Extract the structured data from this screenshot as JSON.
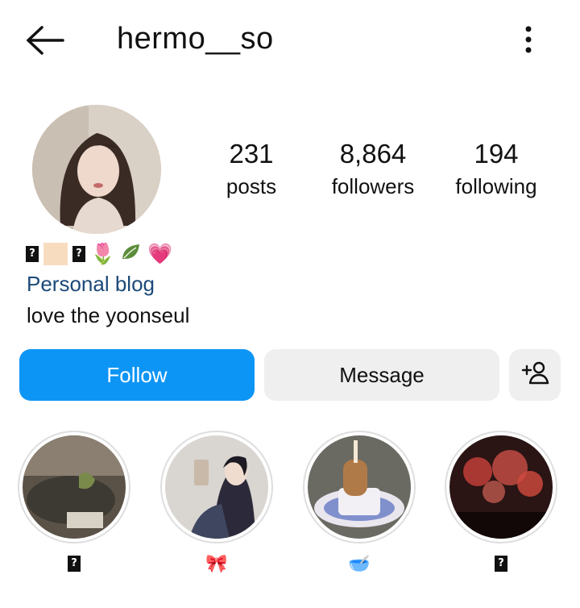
{
  "header": {
    "username": "hermo__so",
    "back_icon": "back-arrow-icon",
    "more_icon": "more-vertical-icon"
  },
  "stats": {
    "posts": {
      "count": "231",
      "label": "posts"
    },
    "followers": {
      "count": "8,864",
      "label": "followers"
    },
    "following": {
      "count": "194",
      "label": "following"
    }
  },
  "bio": {
    "emoji_line": [
      "?",
      "skin-tone-swatch",
      "?",
      "🌷",
      "leaf-icon",
      "💗"
    ],
    "category": "Personal blog",
    "text": "love the yoonseul"
  },
  "actions": {
    "follow_label": "Follow",
    "message_label": "Message",
    "add_user_icon": "add-person-icon"
  },
  "highlights": [
    {
      "label": "?",
      "icon": "missing-glyph"
    },
    {
      "label": "🎀",
      "icon": "ribbon-icon"
    },
    {
      "label": "🥣",
      "icon": "bowl-icon"
    },
    {
      "label": "?",
      "icon": "missing-glyph"
    }
  ],
  "colors": {
    "follow_button": "#0d95f6",
    "secondary_button": "#efefef",
    "link": "#1c4a7a"
  }
}
